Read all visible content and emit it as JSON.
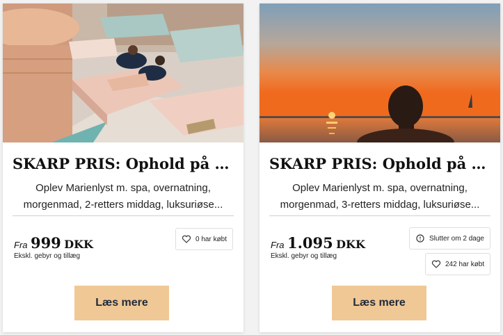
{
  "cards": [
    {
      "title": "SKARP PRIS: Ophold på Mar...",
      "desc_line1": "Oplev Marienlyst m. spa, overnatning,",
      "desc_line2": "morgenmad, 2-retters middag, luksuriøse...",
      "price_prefix": "Fra",
      "price_amount": "999",
      "price_currency": "DKK",
      "fees": "Ekskl. gebyr og tillæg",
      "bought": "0 har købt",
      "button": "Læs mere"
    },
    {
      "title": "SKARP PRIS: Ophold på Mar...",
      "desc_line1": "Oplev Marienlyst m. spa, overnatning,",
      "desc_line2": "morgenmad, 3-retters middag, luksuriøse...",
      "price_prefix": "Fra",
      "price_amount": "1.095",
      "price_currency": "DKK",
      "fees": "Ekskl. gebyr og tillæg",
      "ends": "Slutter om 2 dage",
      "bought": "242 har købt",
      "button": "Læs mere"
    }
  ],
  "colors": {
    "button_bg": "#f0c895",
    "button_text": "#1f2a3a"
  },
  "icons": [
    "heart-icon",
    "clock-icon"
  ]
}
